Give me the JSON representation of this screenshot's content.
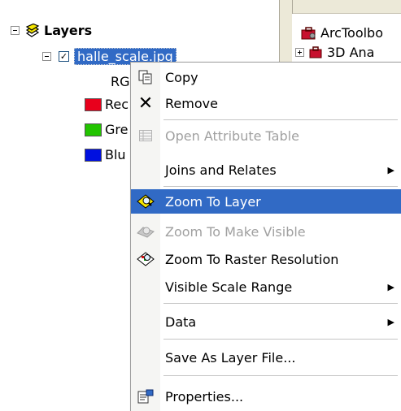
{
  "toc": {
    "layers_title": "Layers",
    "layer_name": "halle_scale.jpg",
    "renderer_label": "RG",
    "bands": [
      {
        "label": "Rec",
        "color": "#e8001c"
      },
      {
        "label": "Gre",
        "color": "#22c400"
      },
      {
        "label": "Blu",
        "color": "#0010e0"
      }
    ]
  },
  "toolbox": {
    "root": "ArcToolbo",
    "items": [
      "3D Ana"
    ]
  },
  "menu": {
    "copy": "Copy",
    "remove": "Remove",
    "open_attr": "Open Attribute Table",
    "joins": "Joins and Relates",
    "zoom_layer": "Zoom To Layer",
    "zoom_visible": "Zoom To Make Visible",
    "zoom_raster": "Zoom To Raster Resolution",
    "visible_scale": "Visible Scale Range",
    "data": "Data",
    "save_layer": "Save As Layer File...",
    "properties": "Properties..."
  },
  "colors": {
    "selection": "#316ac5",
    "menu_gutter": "#f5f5f3",
    "panel_bg": "#ece9d8"
  }
}
